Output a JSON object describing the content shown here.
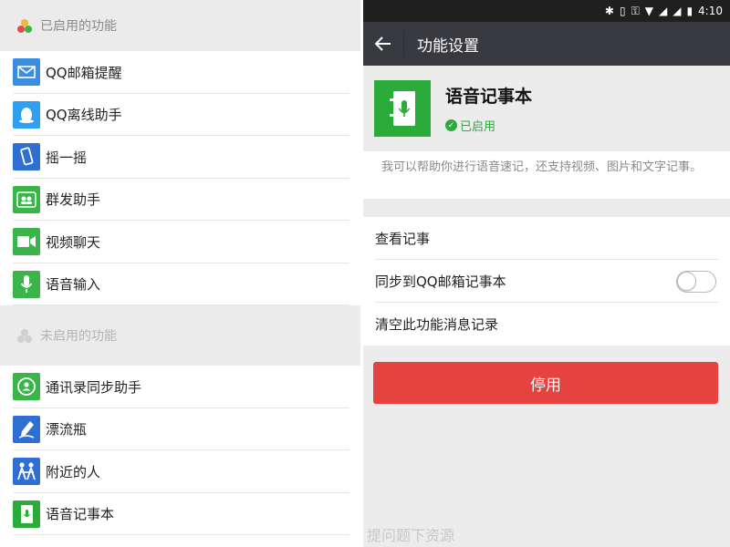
{
  "left": {
    "enabled_header": "已启用的功能",
    "enabled_items": [
      {
        "label": "QQ邮箱提醒",
        "icon": "mail-icon",
        "color": "#3b8de0"
      },
      {
        "label": "QQ离线助手",
        "icon": "qq-penguin-icon",
        "color": "#2ea0ef"
      },
      {
        "label": "摇一摇",
        "icon": "shake-phone-icon",
        "color": "#2f6fd4"
      },
      {
        "label": "群发助手",
        "icon": "group-send-icon",
        "color": "#3bb54a"
      },
      {
        "label": "视频聊天",
        "icon": "video-camera-icon",
        "color": "#3bb54a"
      },
      {
        "label": "语音输入",
        "icon": "microphone-icon",
        "color": "#3bb54a"
      }
    ],
    "disabled_header": "未启用的功能",
    "disabled_items": [
      {
        "label": "通讯录同步助手",
        "icon": "contact-sync-icon",
        "color": "#3bb54a"
      },
      {
        "label": "漂流瓶",
        "icon": "drift-bottle-icon",
        "color": "#2f6fd4"
      },
      {
        "label": "附近的人",
        "icon": "people-nearby-icon",
        "color": "#2f6fd4"
      },
      {
        "label": "语音记事本",
        "icon": "voice-notebook-icon",
        "color": "#2bab3a"
      }
    ]
  },
  "right": {
    "status_bar": {
      "time": "4:10"
    },
    "appbar": {
      "title": "功能设置"
    },
    "feature": {
      "name": "语音记事本",
      "state": "已启用",
      "description": "我可以帮助你进行语音速记，还支持视频、图片和文字记事。"
    },
    "options": [
      {
        "label": "查看记事"
      },
      {
        "label": "同步到QQ邮箱记事本",
        "toggle": false
      },
      {
        "label": "清空此功能消息记录"
      }
    ],
    "disable_button": "停用"
  },
  "watermark": "提问题下资源",
  "colors": {
    "accent_green": "#2bab3a",
    "danger_red": "#e64340",
    "appbar": "#393a3f"
  }
}
